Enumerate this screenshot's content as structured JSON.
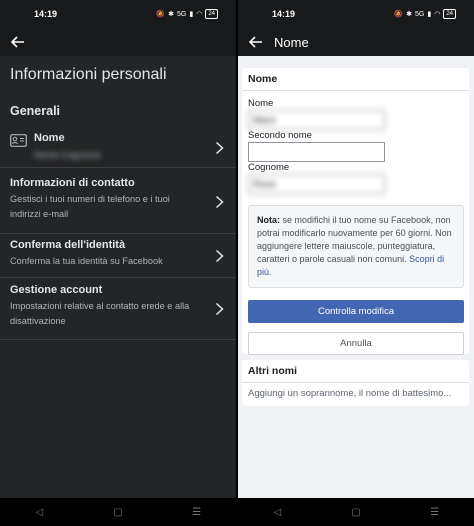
{
  "left": {
    "status": {
      "time": "14:19",
      "signal": "5G",
      "battery": "24"
    },
    "page_title": "Informazioni personali",
    "section_title": "Generali",
    "rows": [
      {
        "title": "Nome",
        "subtitle": "Nome Cognome"
      },
      {
        "title": "Informazioni di contatto",
        "subtitle": "Gestisci i tuoi numeri di telefono e i tuoi indirizzi e-mail"
      },
      {
        "title": "Conferma dell'identità",
        "subtitle": "Conferma la tua identità su Facebook"
      },
      {
        "title": "Gestione account",
        "subtitle": "Impostazioni relative al contatto erede e alla disattivazione"
      }
    ]
  },
  "right": {
    "status": {
      "time": "14:19",
      "signal": "5G",
      "battery": "24"
    },
    "appbar_title": "Nome",
    "card_title": "Nome",
    "fields": {
      "first_label": "Nome",
      "first_value": "Mario",
      "middle_label": "Secondo nome",
      "middle_value": "",
      "last_label": "Cognome",
      "last_value": "Rossi"
    },
    "note": {
      "lead": "Nota:",
      "text": " se modifichi il tuo nome su Facebook, non potrai modificarlo nuovamente per 60 giorni. Non aggiungere lettere maiuscole, punteggiatura, caratteri o parole casuali non comuni. ",
      "link": "Scopri di più."
    },
    "primary_button": "Controlla modifica",
    "secondary_button": "Annulla",
    "altri": {
      "title": "Altri nomi",
      "subtitle": "Aggiungi un soprannome, il nome di battesimo..."
    }
  },
  "colors": {
    "dark_bg": "#242526",
    "accent": "#4267b2",
    "light_bg": "#f0f2f5"
  }
}
